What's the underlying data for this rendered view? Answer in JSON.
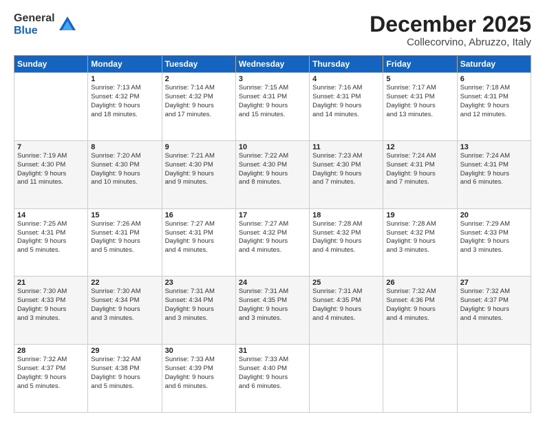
{
  "logo": {
    "general": "General",
    "blue": "Blue"
  },
  "title": {
    "month": "December 2025",
    "location": "Collecorvino, Abruzzo, Italy"
  },
  "days_of_week": [
    "Sunday",
    "Monday",
    "Tuesday",
    "Wednesday",
    "Thursday",
    "Friday",
    "Saturday"
  ],
  "weeks": [
    [
      {
        "day": "",
        "info": ""
      },
      {
        "day": "1",
        "info": "Sunrise: 7:13 AM\nSunset: 4:32 PM\nDaylight: 9 hours\nand 18 minutes."
      },
      {
        "day": "2",
        "info": "Sunrise: 7:14 AM\nSunset: 4:32 PM\nDaylight: 9 hours\nand 17 minutes."
      },
      {
        "day": "3",
        "info": "Sunrise: 7:15 AM\nSunset: 4:31 PM\nDaylight: 9 hours\nand 15 minutes."
      },
      {
        "day": "4",
        "info": "Sunrise: 7:16 AM\nSunset: 4:31 PM\nDaylight: 9 hours\nand 14 minutes."
      },
      {
        "day": "5",
        "info": "Sunrise: 7:17 AM\nSunset: 4:31 PM\nDaylight: 9 hours\nand 13 minutes."
      },
      {
        "day": "6",
        "info": "Sunrise: 7:18 AM\nSunset: 4:31 PM\nDaylight: 9 hours\nand 12 minutes."
      }
    ],
    [
      {
        "day": "7",
        "info": "Sunrise: 7:19 AM\nSunset: 4:30 PM\nDaylight: 9 hours\nand 11 minutes."
      },
      {
        "day": "8",
        "info": "Sunrise: 7:20 AM\nSunset: 4:30 PM\nDaylight: 9 hours\nand 10 minutes."
      },
      {
        "day": "9",
        "info": "Sunrise: 7:21 AM\nSunset: 4:30 PM\nDaylight: 9 hours\nand 9 minutes."
      },
      {
        "day": "10",
        "info": "Sunrise: 7:22 AM\nSunset: 4:30 PM\nDaylight: 9 hours\nand 8 minutes."
      },
      {
        "day": "11",
        "info": "Sunrise: 7:23 AM\nSunset: 4:30 PM\nDaylight: 9 hours\nand 7 minutes."
      },
      {
        "day": "12",
        "info": "Sunrise: 7:24 AM\nSunset: 4:31 PM\nDaylight: 9 hours\nand 7 minutes."
      },
      {
        "day": "13",
        "info": "Sunrise: 7:24 AM\nSunset: 4:31 PM\nDaylight: 9 hours\nand 6 minutes."
      }
    ],
    [
      {
        "day": "14",
        "info": "Sunrise: 7:25 AM\nSunset: 4:31 PM\nDaylight: 9 hours\nand 5 minutes."
      },
      {
        "day": "15",
        "info": "Sunrise: 7:26 AM\nSunset: 4:31 PM\nDaylight: 9 hours\nand 5 minutes."
      },
      {
        "day": "16",
        "info": "Sunrise: 7:27 AM\nSunset: 4:31 PM\nDaylight: 9 hours\nand 4 minutes."
      },
      {
        "day": "17",
        "info": "Sunrise: 7:27 AM\nSunset: 4:32 PM\nDaylight: 9 hours\nand 4 minutes."
      },
      {
        "day": "18",
        "info": "Sunrise: 7:28 AM\nSunset: 4:32 PM\nDaylight: 9 hours\nand 4 minutes."
      },
      {
        "day": "19",
        "info": "Sunrise: 7:28 AM\nSunset: 4:32 PM\nDaylight: 9 hours\nand 3 minutes."
      },
      {
        "day": "20",
        "info": "Sunrise: 7:29 AM\nSunset: 4:33 PM\nDaylight: 9 hours\nand 3 minutes."
      }
    ],
    [
      {
        "day": "21",
        "info": "Sunrise: 7:30 AM\nSunset: 4:33 PM\nDaylight: 9 hours\nand 3 minutes."
      },
      {
        "day": "22",
        "info": "Sunrise: 7:30 AM\nSunset: 4:34 PM\nDaylight: 9 hours\nand 3 minutes."
      },
      {
        "day": "23",
        "info": "Sunrise: 7:31 AM\nSunset: 4:34 PM\nDaylight: 9 hours\nand 3 minutes."
      },
      {
        "day": "24",
        "info": "Sunrise: 7:31 AM\nSunset: 4:35 PM\nDaylight: 9 hours\nand 3 minutes."
      },
      {
        "day": "25",
        "info": "Sunrise: 7:31 AM\nSunset: 4:35 PM\nDaylight: 9 hours\nand 4 minutes."
      },
      {
        "day": "26",
        "info": "Sunrise: 7:32 AM\nSunset: 4:36 PM\nDaylight: 9 hours\nand 4 minutes."
      },
      {
        "day": "27",
        "info": "Sunrise: 7:32 AM\nSunset: 4:37 PM\nDaylight: 9 hours\nand 4 minutes."
      }
    ],
    [
      {
        "day": "28",
        "info": "Sunrise: 7:32 AM\nSunset: 4:37 PM\nDaylight: 9 hours\nand 5 minutes."
      },
      {
        "day": "29",
        "info": "Sunrise: 7:32 AM\nSunset: 4:38 PM\nDaylight: 9 hours\nand 5 minutes."
      },
      {
        "day": "30",
        "info": "Sunrise: 7:33 AM\nSunset: 4:39 PM\nDaylight: 9 hours\nand 6 minutes."
      },
      {
        "day": "31",
        "info": "Sunrise: 7:33 AM\nSunset: 4:40 PM\nDaylight: 9 hours\nand 6 minutes."
      },
      {
        "day": "",
        "info": ""
      },
      {
        "day": "",
        "info": ""
      },
      {
        "day": "",
        "info": ""
      }
    ]
  ]
}
